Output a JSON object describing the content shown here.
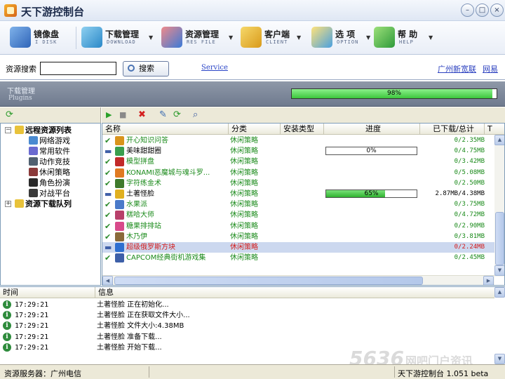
{
  "window": {
    "title": "天下游控制台"
  },
  "toolbar": [
    {
      "label": "镜像盘",
      "sub": "I DISK"
    },
    {
      "label": "下载管理",
      "sub": "DOWNLOAD"
    },
    {
      "label": "资源管理",
      "sub": "RES FILE"
    },
    {
      "label": "客户端",
      "sub": "CLIENT"
    },
    {
      "label": "选 项",
      "sub": "OPTION"
    },
    {
      "label": "帮 助",
      "sub": "HELP"
    }
  ],
  "search": {
    "label": "资源搜索",
    "value": "",
    "button": "搜索",
    "service_link": "Service",
    "links": [
      "广州新宽联",
      "网易"
    ]
  },
  "download_panel": {
    "title": "下载管理",
    "subtitle": "Plugins",
    "progress": 98,
    "progress_text": "98%"
  },
  "tree": {
    "root1": "远程资源列表",
    "children": [
      "网络游戏",
      "常用软件",
      "动作竞技",
      "休闲策略",
      "角色扮演",
      "对战平台"
    ],
    "root2": "资源下载队列"
  },
  "columns": [
    "名称",
    "分类",
    "安装类型",
    "进度",
    "已下载/总计",
    "T"
  ],
  "rows": [
    {
      "name": "开心知识问答",
      "category": "休闲策略",
      "size": "0/2.35MB",
      "status": "done",
      "color": "#1a8a1a",
      "icon": "#d9941c",
      "progress": null,
      "progress_text": "",
      "selected": false
    },
    {
      "name": "美味甜甜圈",
      "category": "休闲策略",
      "size": "0/4.75MB",
      "status": "queued",
      "color": "#000000",
      "icon": "#3a9e4e",
      "progress": 0,
      "progress_text": "0%",
      "selected": false
    },
    {
      "name": "模型拼盘",
      "category": "休闲策略",
      "size": "0/3.42MB",
      "status": "done",
      "color": "#1a8a1a",
      "icon": "#c22a2a",
      "progress": null,
      "progress_text": "",
      "selected": false
    },
    {
      "name": "KONAMI恶魔城与魂斗罗...",
      "category": "休闲策略",
      "size": "0/5.08MB",
      "status": "done",
      "color": "#1a8a1a",
      "icon": "#e07a22",
      "progress": null,
      "progress_text": "",
      "selected": false
    },
    {
      "name": "字符练金术",
      "category": "休闲策略",
      "size": "0/2.50MB",
      "status": "done",
      "color": "#1a8a1a",
      "icon": "#3f7a2c",
      "progress": null,
      "progress_text": "",
      "selected": false
    },
    {
      "name": "土著怪脸",
      "category": "休闲策略",
      "size": "2.87MB/4.38MB",
      "status": "downloading",
      "color": "#000000",
      "icon": "#e0b020",
      "progress": 65,
      "progress_text": "65%",
      "selected": false
    },
    {
      "name": "水果派",
      "category": "休闲策略",
      "size": "0/3.75MB",
      "status": "done",
      "color": "#1a8a1a",
      "icon": "#4a7ac9",
      "progress": null,
      "progress_text": "",
      "selected": false
    },
    {
      "name": "糕哈大师",
      "category": "休闲策略",
      "size": "0/4.72MB",
      "status": "done",
      "color": "#1a8a1a",
      "icon": "#b8406a",
      "progress": null,
      "progress_text": "",
      "selected": false
    },
    {
      "name": "糖果排排站",
      "category": "休闲策略",
      "size": "0/2.90MB",
      "status": "done",
      "color": "#1a8a1a",
      "icon": "#d84a8a",
      "progress": null,
      "progress_text": "",
      "selected": false
    },
    {
      "name": "木乃伊",
      "category": "休闲策略",
      "size": "0/3.81MB",
      "status": "done",
      "color": "#1a8a1a",
      "icon": "#8a6a3a",
      "progress": null,
      "progress_text": "",
      "selected": false
    },
    {
      "name": "超级俄罗斯方块",
      "category": "休闲策略",
      "size": "0/2.24MB",
      "status": "queued",
      "color": "#d41a1a",
      "icon": "#2e6fd0",
      "progress": null,
      "progress_text": "",
      "selected": true
    },
    {
      "name": "CAPCOM经典街机游戏集",
      "category": "休闲策略",
      "size": "0/2.45MB",
      "status": "done",
      "color": "#1a8a1a",
      "icon": "#3d5fa8",
      "progress": null,
      "progress_text": "",
      "selected": false
    }
  ],
  "log": {
    "columns": [
      "时间",
      "信息"
    ],
    "entries": [
      {
        "time": "17:29:21",
        "msg": "土著怪脸 正在初始化..."
      },
      {
        "time": "17:29:21",
        "msg": "土著怪脸 正在获取文件大小..."
      },
      {
        "time": "17:29:21",
        "msg": "土著怪脸 文件大小:4.38MB"
      },
      {
        "time": "17:29:21",
        "msg": "土著怪脸 准备下载..."
      },
      {
        "time": "17:29:21",
        "msg": "土著怪脸 开始下载..."
      }
    ]
  },
  "statusbar": {
    "server": "资源服务器：广州电信",
    "version": "天下游控制台 1.051 beta"
  },
  "watermark": {
    "text": "5636",
    "suffix": "网吧门户资讯"
  }
}
